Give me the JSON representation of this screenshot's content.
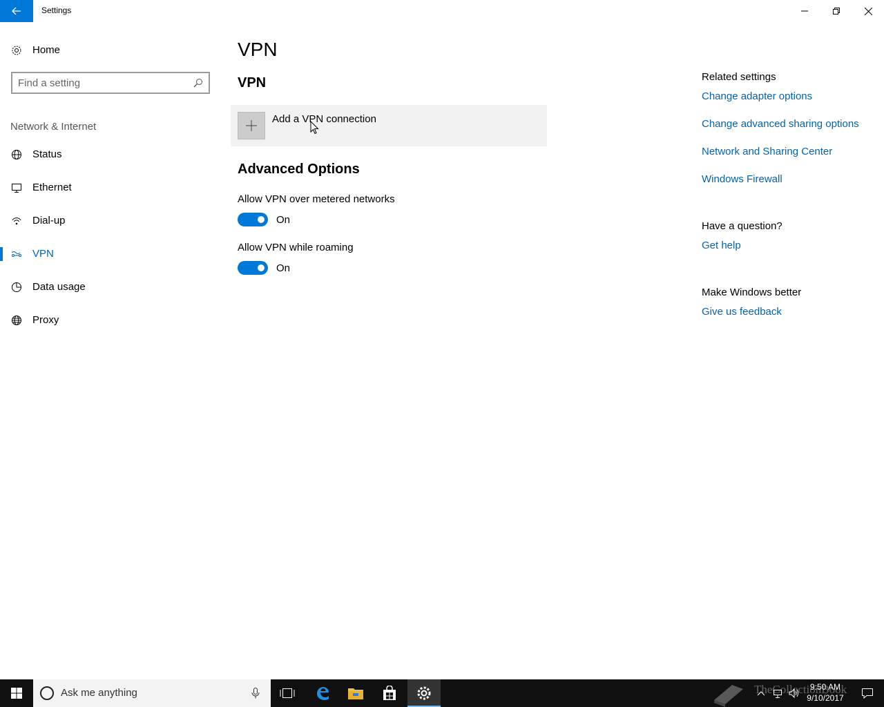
{
  "window": {
    "title": "Settings",
    "icons": {
      "back": "back-arrow-icon",
      "minimize": "minimize-icon",
      "maximize": "restore-icon",
      "close": "close-icon"
    }
  },
  "sidebar": {
    "home_label": "Home",
    "search_placeholder": "Find a setting",
    "section_label": "Network & Internet",
    "items": [
      {
        "label": "Status",
        "icon": "globe-network-icon"
      },
      {
        "label": "Ethernet",
        "icon": "ethernet-icon"
      },
      {
        "label": "Dial-up",
        "icon": "dialup-icon"
      },
      {
        "label": "VPN",
        "icon": "vpn-icon",
        "active": true
      },
      {
        "label": "Data usage",
        "icon": "data-usage-icon"
      },
      {
        "label": "Proxy",
        "icon": "globe-icon"
      }
    ]
  },
  "main": {
    "page_title": "VPN",
    "section_title": "VPN",
    "add_vpn_label": "Add a VPN connection",
    "advanced_title": "Advanced Options",
    "options": [
      {
        "label": "Allow VPN over metered networks",
        "state": "On",
        "enabled": true
      },
      {
        "label": "Allow VPN while roaming",
        "state": "On",
        "enabled": true
      }
    ]
  },
  "related": {
    "heading": "Related settings",
    "links": [
      "Change adapter options",
      "Change advanced sharing options",
      "Network and Sharing Center",
      "Windows Firewall"
    ],
    "question_heading": "Have a question?",
    "help_link": "Get help",
    "better_heading": "Make Windows better",
    "feedback_link": "Give us feedback"
  },
  "taskbar": {
    "search_text": "Ask me anything",
    "time": "9:50 AM",
    "date": "9/10/2017",
    "watermark": "TheCollectionBook"
  },
  "colors": {
    "accent": "#0078d7",
    "link": "#0063b1",
    "taskbar": "#101010"
  }
}
